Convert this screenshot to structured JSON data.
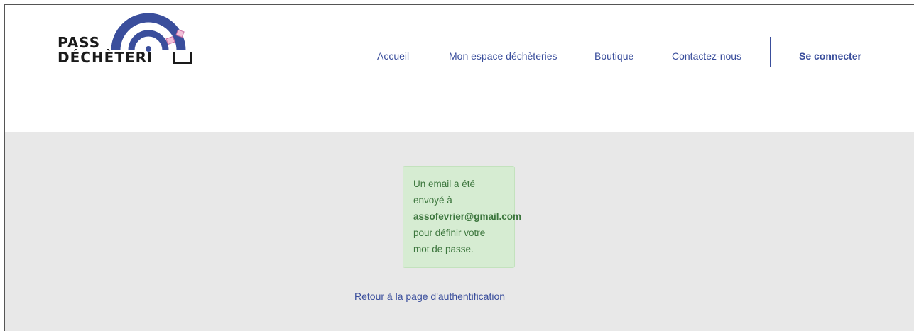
{
  "logo": {
    "line1": "PASS",
    "line2": "DÉCHÈTERI",
    "colors": {
      "arc_outer": "#3a4e9c",
      "arc_inner": "#3a4e9c",
      "accent": "#e8a2c6",
      "text": "#1a1a1a"
    }
  },
  "nav": {
    "items": [
      {
        "label": "Accueil"
      },
      {
        "label": "Mon espace déchèteries"
      },
      {
        "label": "Boutique"
      },
      {
        "label": "Contactez-nous"
      }
    ],
    "login_label": "Se connecter"
  },
  "alert": {
    "line1": "Un email a été",
    "line2": "envoyé à",
    "email": "assofevrier@gmail.com",
    "line3": "pour définir votre",
    "line4": "mot de passe."
  },
  "back_link": "Retour à la page d'authentification",
  "colors": {
    "brand": "#3a4e9c",
    "success_bg": "#d6ecd2",
    "success_text": "#3c763d",
    "content_bg": "#e8e8e8"
  }
}
